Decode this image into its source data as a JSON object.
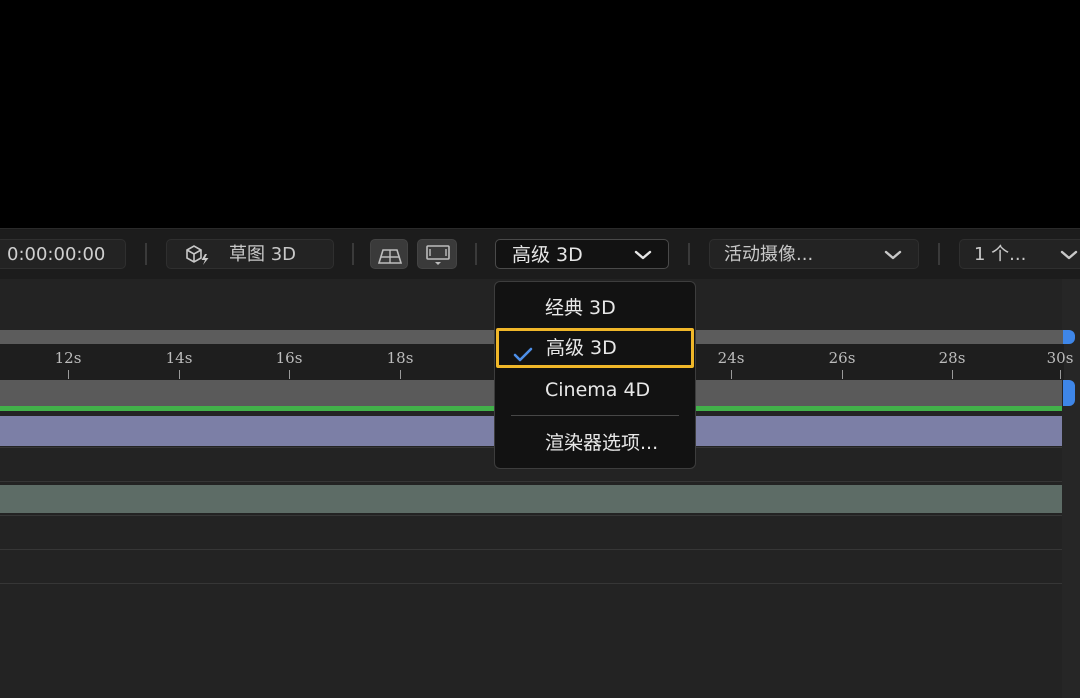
{
  "toolbar": {
    "timecode": "0:00:00:00",
    "draft3d_label": "草图 3D",
    "renderer_value": "高级 3D",
    "camera_value": "活动摄像...",
    "views_value": "1 个..."
  },
  "ruler": {
    "ticks": [
      "12s",
      "14s",
      "16s",
      "18s",
      "24s",
      "26s",
      "28s",
      "30s"
    ]
  },
  "renderer_menu": {
    "items": [
      "经典 3D",
      "高级 3D",
      "Cinema 4D"
    ],
    "selected": "高级 3D",
    "options_label": "渲染器选项..."
  },
  "colors": {
    "accent_highlight": "#f0b729",
    "check": "#4d8fe8",
    "work_area_handle": "#3e86e8",
    "green_bar": "#42b14a",
    "layer_purple": "#7c7fa6",
    "layer_gray": "#5d6c66"
  },
  "icons": {
    "draft3d": "draft-3d-icon",
    "ground_plane": "ground-plane-icon",
    "extended_viewer": "extended-viewer-icon",
    "chevron": "chevron-down-icon",
    "check": "checkmark-icon"
  }
}
